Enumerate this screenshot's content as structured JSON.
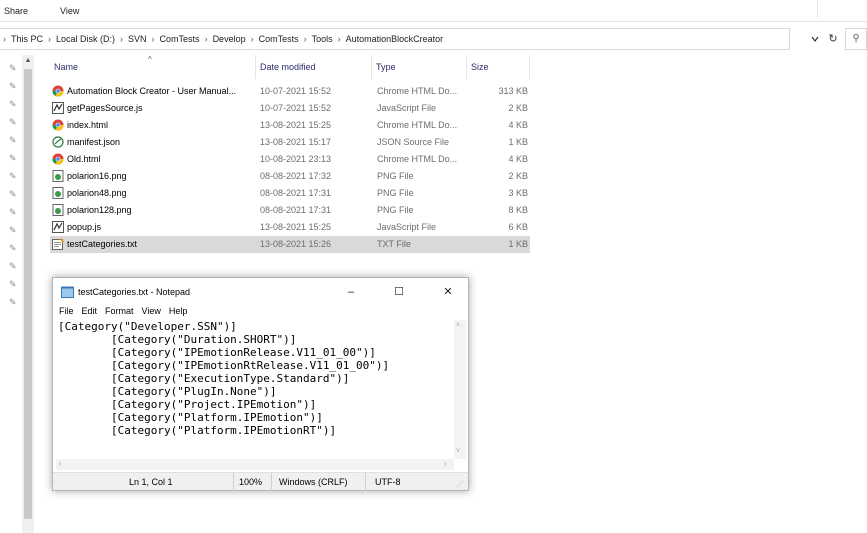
{
  "ribbon": {
    "tabs": [
      "Share",
      "View"
    ]
  },
  "address": {
    "crumbs": [
      "This PC",
      "Local Disk (D:)",
      "SVN",
      "ComTests",
      "Develop",
      "ComTests",
      "Tools",
      "AutomationBlockCreator"
    ],
    "separator": "›"
  },
  "columns": {
    "name": "Name",
    "date": "Date modified",
    "type": "Type",
    "size": "Size"
  },
  "files": [
    {
      "name": "Automation Block Creator - User Manual...",
      "date": "10-07-2021 15:52",
      "type": "Chrome HTML Do...",
      "size": "313 KB",
      "icon": "chrome-icon"
    },
    {
      "name": "getPagesSource.js",
      "date": "10-07-2021 15:52",
      "type": "JavaScript File",
      "size": "2 KB",
      "icon": "js-file-icon"
    },
    {
      "name": "index.html",
      "date": "13-08-2021 15:25",
      "type": "Chrome HTML Do...",
      "size": "4 KB",
      "icon": "chrome-icon"
    },
    {
      "name": "manifest.json",
      "date": "13-08-2021 15:17",
      "type": "JSON Source File",
      "size": "1 KB",
      "icon": "json-file-icon"
    },
    {
      "name": "Old.html",
      "date": "10-08-2021 23:13",
      "type": "Chrome HTML Do...",
      "size": "4 KB",
      "icon": "chrome-icon"
    },
    {
      "name": "polarion16.png",
      "date": "08-08-2021 17:32",
      "type": "PNG File",
      "size": "2 KB",
      "icon": "png-file-icon"
    },
    {
      "name": "polarion48.png",
      "date": "08-08-2021 17:31",
      "type": "PNG File",
      "size": "3 KB",
      "icon": "png-file-icon"
    },
    {
      "name": "polarion128.png",
      "date": "08-08-2021 17:31",
      "type": "PNG File",
      "size": "8 KB",
      "icon": "png-file-icon"
    },
    {
      "name": "popup.js",
      "date": "13-08-2021 15:25",
      "type": "JavaScript File",
      "size": "6 KB",
      "icon": "js-file-icon"
    },
    {
      "name": "testCategories.txt",
      "date": "13-08-2021 15:26",
      "type": "TXT File",
      "size": "1 KB",
      "icon": "txt-file-icon",
      "selected": true
    }
  ],
  "notepad": {
    "title": "testCategories.txt - Notepad",
    "controls": {
      "minimize": "–",
      "maximize": "☐",
      "close": "✕"
    },
    "menus": [
      "File",
      "Edit",
      "Format",
      "View",
      "Help"
    ],
    "content": "[Category(\"Developer.SSN\")]\n        [Category(\"Duration.SHORT\")]\n        [Category(\"IPEmotionRelease.V11_01_00\")]\n        [Category(\"IPEmotionRtRelease.V11_01_00\")]\n        [Category(\"ExecutionType.Standard\")]\n        [Category(\"PlugIn.None\")]\n        [Category(\"Project.IPEmotion\")]\n        [Category(\"Platform.IPEmotion\")]\n        [Category(\"Platform.IPEmotionRT\")]",
    "status": {
      "position": "Ln 1, Col 1",
      "zoom": "100%",
      "line_endings": "Windows (CRLF)",
      "encoding": "UTF-8"
    }
  },
  "colors": {
    "selected_row": "#d9d9d9",
    "header_text": "#2c2c6a",
    "chrome_red": "#db4437",
    "chrome_yellow": "#f4c20d",
    "chrome_green": "#0f9d58",
    "chrome_blue": "#4285f4"
  }
}
